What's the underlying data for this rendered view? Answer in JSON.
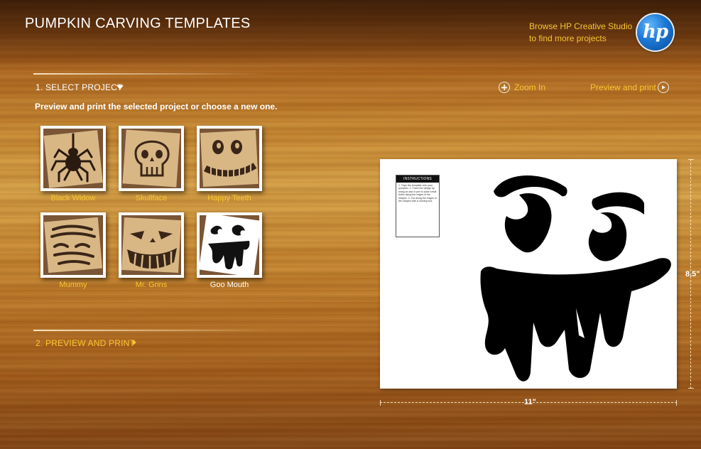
{
  "header": {
    "title": "PUMPKIN CARVING TEMPLATES",
    "browse_line1": "Browse HP Creative Studio",
    "browse_line2": "to find more projects",
    "logo_text": "hp"
  },
  "step1": {
    "label": "1. SELECT PROJECT",
    "subtitle": "Preview and print the selected project or choose a new one."
  },
  "projects": [
    {
      "label": "Black Widow",
      "icon": "spider-icon",
      "selected": false
    },
    {
      "label": "Skullface",
      "icon": "skull-icon",
      "selected": false
    },
    {
      "label": "Happy Teeth",
      "icon": "happy-teeth-icon",
      "selected": false
    },
    {
      "label": "Mummy",
      "icon": "mummy-icon",
      "selected": false
    },
    {
      "label": "Mr. Grins",
      "icon": "grin-icon",
      "selected": false
    },
    {
      "label": "Goo Mouth",
      "icon": "goo-mouth-icon",
      "selected": true
    }
  ],
  "step2": {
    "label": "2. PREVIEW AND PRINT"
  },
  "toolbar": {
    "zoom_label": "Zoom In",
    "print_label": "Preview and print"
  },
  "preview": {
    "instructions_title": "INSTRUCTIONS",
    "instructions_text": "1. Tape the template onto your pumpkin. 2. Trace the design by using an awl or pen to poke small holes along the edges of the shapes. 3. Cut along the edges of the shapes with a carving tool.",
    "width_label": "11\"",
    "height_label": "8.5\""
  },
  "colors": {
    "accent": "#f7c631",
    "text": "#ffffff"
  }
}
